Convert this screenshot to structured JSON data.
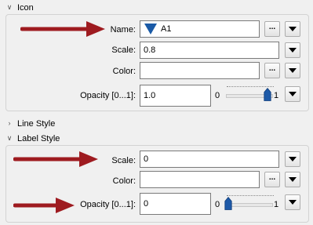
{
  "icon_section": {
    "title": "Icon",
    "name_label": "Name:",
    "name_value": "A1",
    "scale_label": "Scale:",
    "scale_value": "0.8",
    "color_label": "Color:",
    "color_value": "",
    "opacity_label": "Opacity [0...1]:",
    "opacity_value": "1.0",
    "slider_min": "0",
    "slider_max": "1",
    "slider_level": 1.0,
    "browse_label": "..."
  },
  "line_style": {
    "title": "Line Style"
  },
  "label_style": {
    "title": "Label Style",
    "scale_label": "Scale:",
    "scale_value": "0",
    "color_label": "Color:",
    "color_value": "",
    "opacity_label": "Opacity [0...1]:",
    "opacity_value": "0",
    "slider_min": "0",
    "slider_max": "1",
    "slider_level": 0.0,
    "browse_label": "..."
  },
  "colors": {
    "arrow": "#9e1b20",
    "thumb": "#1e5aa8",
    "symbol": "#1a5aa6"
  },
  "icons": [
    "chevron-down-icon",
    "chevron-right-icon",
    "triangle-symbol-icon",
    "dropdown-arrow-icon",
    "red-annotation-arrow-icon"
  ]
}
